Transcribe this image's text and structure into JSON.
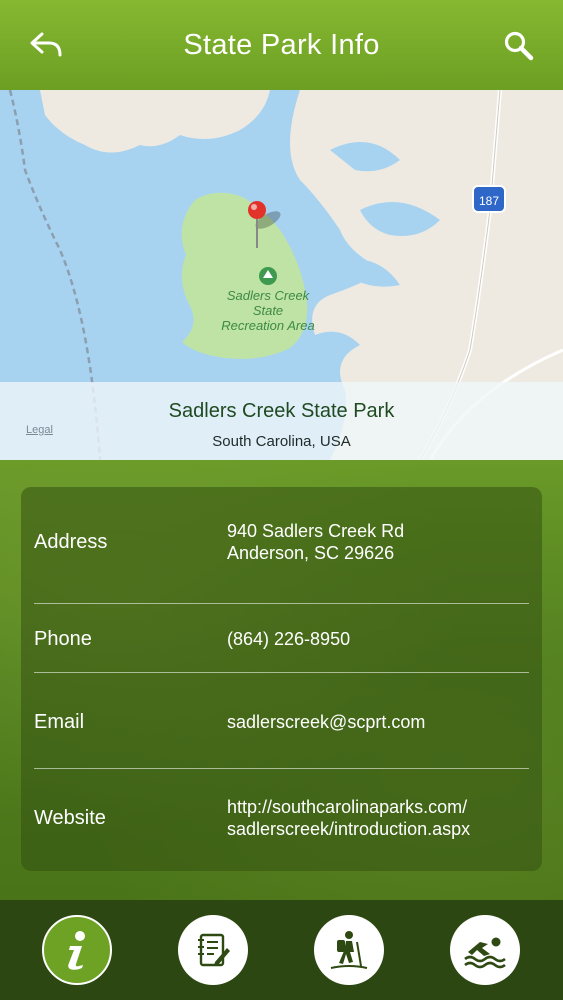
{
  "header": {
    "title": "State Park Info",
    "back_icon": "back-arrow-icon",
    "search_icon": "search-icon"
  },
  "map": {
    "park_name": "Sadlers Creek State Park",
    "region": "South Carolina, USA",
    "legal": "Legal",
    "area_label_1": "Sadlers Creek",
    "area_label_2": "State",
    "area_label_3": "Recreation Area",
    "route_shield": "187"
  },
  "info": {
    "rows": [
      {
        "label": "Address",
        "value_line1": "940 Sadlers Creek Rd",
        "value_line2": "Anderson, SC 29626"
      },
      {
        "label": "Phone",
        "value_line1": "(864) 226-8950",
        "value_line2": ""
      },
      {
        "label": "Email",
        "value_line1": "sadlerscreek@scprt.com",
        "value_line2": ""
      },
      {
        "label": "Website",
        "value_line1": "http://southcarolinaparks.com/",
        "value_line2": "sadlerscreek/introduction.aspx"
      }
    ]
  },
  "tabs": [
    {
      "icon": "info-icon",
      "active": true
    },
    {
      "icon": "notes-icon",
      "active": false
    },
    {
      "icon": "hiking-icon",
      "active": false
    },
    {
      "icon": "swimming-icon",
      "active": false
    }
  ],
  "colors": {
    "header_green": "#7aad2a",
    "pin_red": "#e2332b",
    "water": "#a7d3f0",
    "land": "#eeeae2",
    "park_green": "#bfe3a4"
  }
}
